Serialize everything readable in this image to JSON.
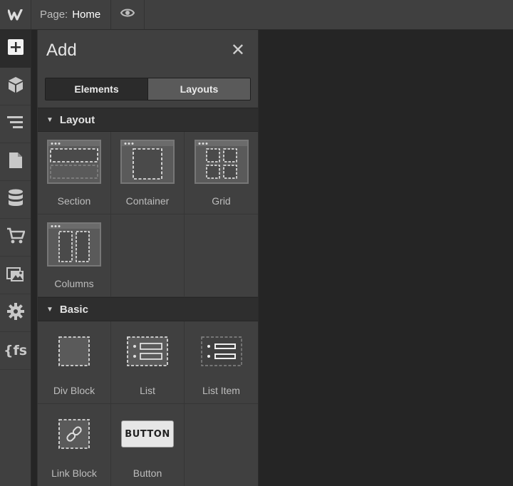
{
  "topbar": {
    "logo_icon": "webflow-logo-icon",
    "page_label": "Page:",
    "page_name": "Home",
    "preview_icon": "eye-icon"
  },
  "left_toolbar": {
    "items": [
      {
        "icon": "add-plus-icon",
        "active": true
      },
      {
        "icon": "cube-icon"
      },
      {
        "icon": "navigator-layers-icon"
      },
      {
        "icon": "pages-icon"
      },
      {
        "icon": "cms-database-icon"
      },
      {
        "icon": "ecommerce-cart-icon"
      },
      {
        "icon": "assets-images-icon"
      },
      {
        "icon": "settings-gear-icon"
      },
      {
        "icon": "finsweet-fs-icon",
        "text": "{fs"
      }
    ]
  },
  "add_panel": {
    "title": "Add",
    "close_icon": "close-icon",
    "tabs": [
      {
        "label": "Elements",
        "active": true
      },
      {
        "label": "Layouts",
        "active": false
      }
    ],
    "sections": [
      {
        "title": "Layout",
        "items": [
          {
            "label": "Section",
            "icon": "section-icon"
          },
          {
            "label": "Container",
            "icon": "container-icon"
          },
          {
            "label": "Grid",
            "icon": "grid-icon"
          },
          {
            "label": "Columns",
            "icon": "columns-icon"
          }
        ]
      },
      {
        "title": "Basic",
        "items": [
          {
            "label": "Div Block",
            "icon": "div-block-icon"
          },
          {
            "label": "List",
            "icon": "list-icon"
          },
          {
            "label": "List Item",
            "icon": "list-item-icon"
          },
          {
            "label": "Link Block",
            "icon": "link-block-icon"
          },
          {
            "label": "Button",
            "icon": "button-element-icon",
            "preview_text": "BUTTON"
          }
        ]
      }
    ]
  },
  "colors": {
    "chrome": "#404040",
    "canvas": "#252525",
    "section_header": "#2e2e2e"
  }
}
